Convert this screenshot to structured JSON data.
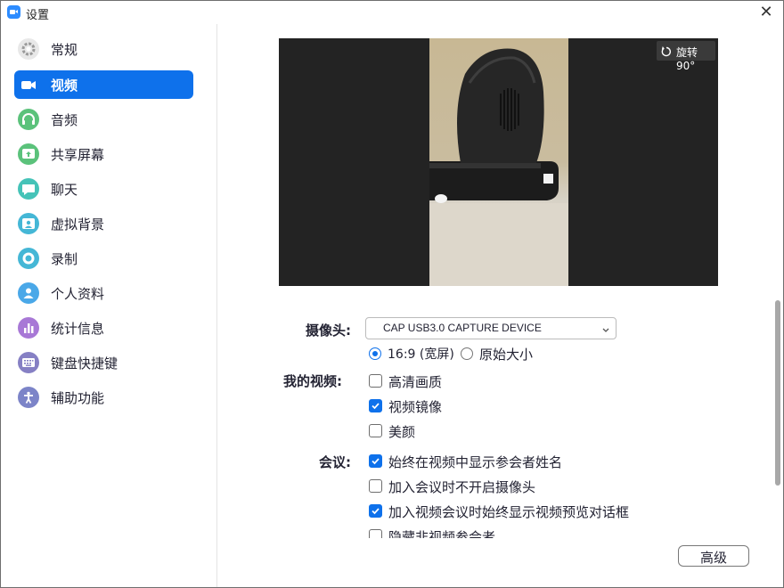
{
  "window": {
    "title": "设置",
    "close_glyph": "✕"
  },
  "sidebar": {
    "items": [
      {
        "label": "常规",
        "icon": "gear-icon",
        "color": "#e5e5e5",
        "active": false
      },
      {
        "label": "视频",
        "icon": "camera-icon",
        "color": "#0e71eb",
        "active": true
      },
      {
        "label": "音频",
        "icon": "headphones-icon",
        "color": "#5bc27b",
        "active": false
      },
      {
        "label": "共享屏幕",
        "icon": "share-screen-icon",
        "color": "#5bc27b",
        "active": false
      },
      {
        "label": "聊天",
        "icon": "chat-bubble-icon",
        "color": "#45c3b8",
        "active": false
      },
      {
        "label": "虚拟背景",
        "icon": "virtual-background-icon",
        "color": "#45b7d6",
        "active": false
      },
      {
        "label": "录制",
        "icon": "record-icon",
        "color": "#45b7d6",
        "active": false
      },
      {
        "label": "个人资料",
        "icon": "profile-icon",
        "color": "#4aa8e8",
        "active": false
      },
      {
        "label": "统计信息",
        "icon": "statistics-icon",
        "color": "#a878d6",
        "active": false
      },
      {
        "label": "键盘快捷键",
        "icon": "keyboard-icon",
        "color": "#8680c4",
        "active": false
      },
      {
        "label": "辅助功能",
        "icon": "accessibility-icon",
        "color": "#7c84c8",
        "active": false
      }
    ]
  },
  "preview": {
    "rotate_label": "旋转90°"
  },
  "camera": {
    "label": "摄像头:",
    "selected": "CAP USB3.0 CAPTURE DEVICE"
  },
  "aspect": {
    "options": [
      {
        "label": "16:9 (宽屏)",
        "checked": true
      },
      {
        "label": "原始大小",
        "checked": false
      }
    ]
  },
  "my_video": {
    "label": "我的视频:",
    "options": [
      {
        "label": "高清画质",
        "checked": false
      },
      {
        "label": "视频镜像",
        "checked": true
      },
      {
        "label": "美颜",
        "checked": false
      }
    ]
  },
  "meeting": {
    "label": "会议:",
    "options": [
      {
        "label": "始终在视频中显示参会者姓名",
        "checked": true
      },
      {
        "label": "加入会议时不开启摄像头",
        "checked": false
      },
      {
        "label": "加入视频会议时始终显示视频预览对话框",
        "checked": true
      },
      {
        "label": "隐藏非视频参会者",
        "checked": false
      }
    ]
  },
  "advanced_button": "高级",
  "accent_color": "#0e71eb"
}
